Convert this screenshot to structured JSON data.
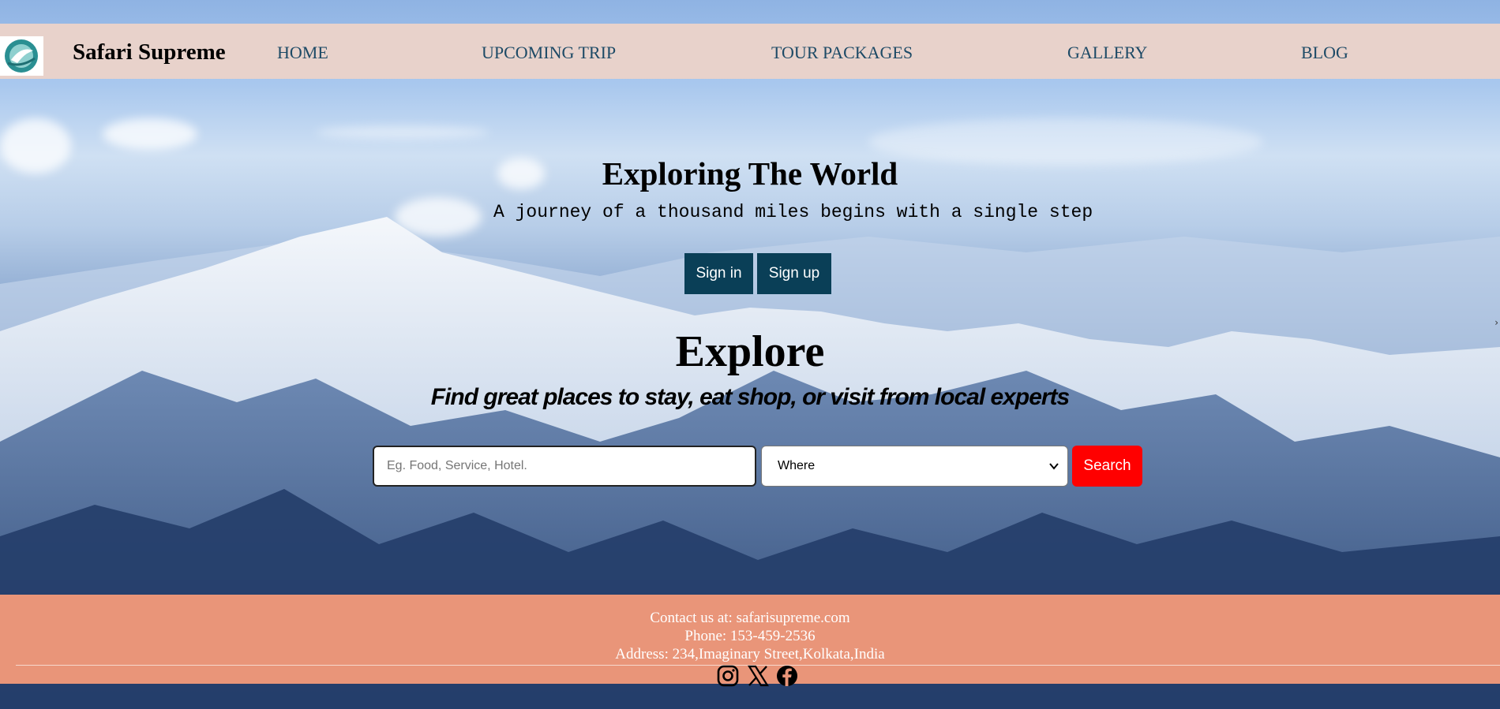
{
  "nav": {
    "brand": "Safari Supreme",
    "logo_icon": "globe-plane-logo",
    "items": [
      {
        "label": "HOME"
      },
      {
        "label": "UPCOMING TRIP"
      },
      {
        "label": "TOUR PACKAGES"
      },
      {
        "label": "GALLERY"
      },
      {
        "label": "BLOG"
      }
    ]
  },
  "hero": {
    "title": "Exploring The World",
    "subtitle": "A journey of a thousand miles begins with a single step",
    "signin_label": "Sign in",
    "signup_label": "Sign up"
  },
  "explore": {
    "title": "Explore",
    "subtitle": "Find great places to stay, eat shop, or visit from local experts",
    "search_placeholder": "Eg. Food, Service, Hotel.",
    "where_selected": "Where",
    "search_label": "Search"
  },
  "footer": {
    "contact": "Contact us at: safarisupreme.com",
    "phone": "Phone: 153-459-2536",
    "address": "Address: 234,Imaginary Street,Kolkata,India",
    "social_icons": [
      "instagram-icon",
      "x-icon",
      "facebook-icon"
    ]
  },
  "colors": {
    "nav_bg": "#e8d2cb",
    "nav_text": "#1d4a66",
    "button_dark": "#0a3f57",
    "search_button": "#ff0000",
    "footer_bg": "#e99579"
  }
}
